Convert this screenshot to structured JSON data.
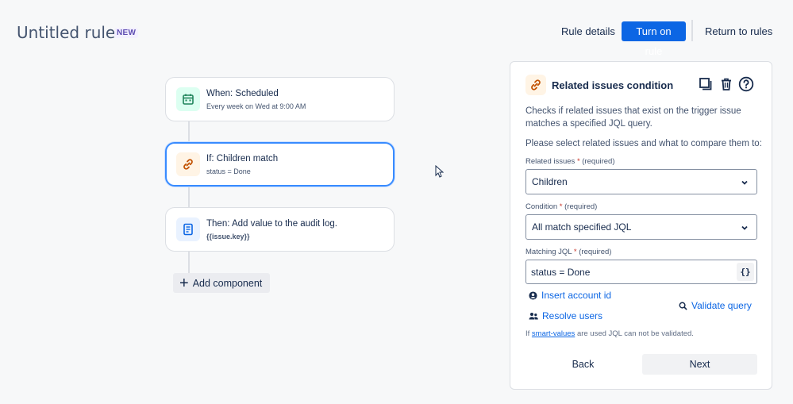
{
  "header": {
    "title": "Untitled rule",
    "badge": "NEW",
    "rule_details": "Rule details",
    "turn_on": "Turn on rule",
    "return": "Return to rules"
  },
  "flow": {
    "trigger": {
      "title": "When: Scheduled",
      "sub": "Every week on Wed at 9:00 AM",
      "icon": "calendar-icon"
    },
    "condition": {
      "title": "If: Children match",
      "sub": "status = Done",
      "icon": "link-icon"
    },
    "action": {
      "title": "Then: Add value to the audit log.",
      "sub": "{{issue.key}}",
      "icon": "document-icon"
    },
    "add_component": "Add component"
  },
  "panel": {
    "title": "Related issues condition",
    "description": "Checks if related issues that exist on the trigger issue matches a specified JQL query.",
    "prompt": "Please select related issues and what to compare them to:",
    "related": {
      "label": "Related issues",
      "req_mark": "*",
      "req_text": "(required)",
      "value": "Children"
    },
    "condition": {
      "label": "Condition",
      "req_mark": "*",
      "req_text": "(required)",
      "value": "All match specified JQL"
    },
    "jql": {
      "label": "Matching JQL",
      "req_mark": "*",
      "req_text": "(required)",
      "value": "status = Done",
      "braces": "{}"
    },
    "insert_account": "Insert account id",
    "resolve_users": "Resolve users",
    "validate": "Validate query",
    "note_prefix": "If",
    "note_link": "smart-values",
    "note_suffix": "are used JQL can not be validated.",
    "back": "Back",
    "next": "Next"
  },
  "colors": {
    "primary": "#0c66e4",
    "selected_border": "#388bff",
    "badge": "#5e4db2"
  }
}
